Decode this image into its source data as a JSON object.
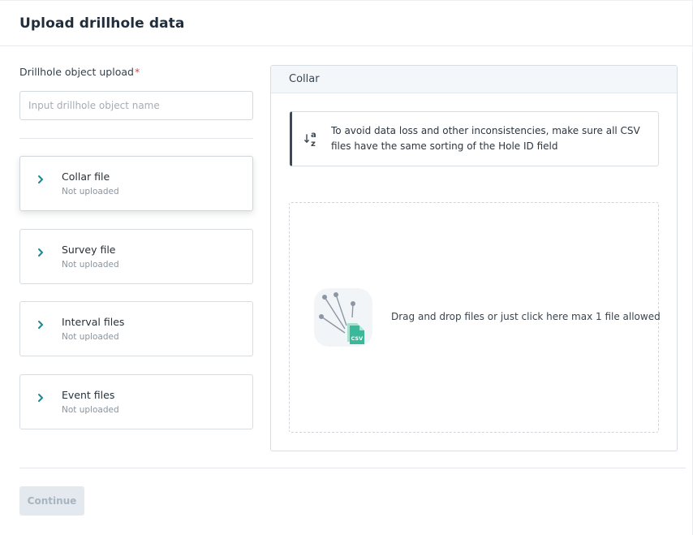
{
  "header": {
    "title": "Upload drillhole data"
  },
  "form": {
    "label": "Drillhole object upload",
    "required_mark": "*",
    "input_placeholder": "Input drillhole object name",
    "input_value": ""
  },
  "files": [
    {
      "title": "Collar file",
      "status": "Not uploaded",
      "active": true
    },
    {
      "title": "Survey file",
      "status": "Not uploaded",
      "active": false
    },
    {
      "title": "Interval files",
      "status": "Not uploaded",
      "active": false
    },
    {
      "title": "Event files",
      "status": "Not uploaded",
      "active": false
    }
  ],
  "panel": {
    "title": "Collar",
    "notice": "To avoid data loss and other inconsistencies, make sure all CSV files have the same sorting of the Hole ID field",
    "dropzone_text": "Drag and drop files or just click here max 1 file allowed",
    "file_badge": "CSV"
  },
  "footer": {
    "continue_label": "Continue",
    "continue_disabled": true
  },
  "colors": {
    "accent_teal": "#1b8a8f",
    "csv_green": "#3ab89a",
    "notice_bar": "#3a4a5c",
    "required": "#e0434b"
  },
  "icons": {
    "chevron": "chevron-right-icon",
    "sort": "sort-az-icon",
    "upload": "csv-upload-illustration"
  }
}
